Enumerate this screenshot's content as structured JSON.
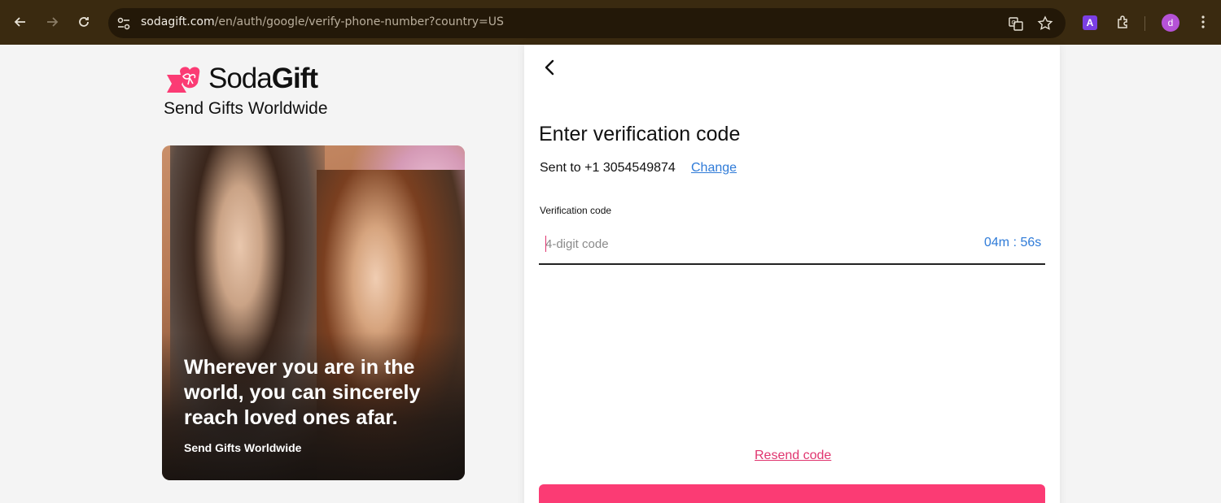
{
  "browser": {
    "url_host": "sodagift.com",
    "url_path": "/en/auth/google/verify-phone-number?country=US",
    "extension_label": "A",
    "profile_initial": "d"
  },
  "brand": {
    "name_light": "Soda",
    "name_bold": "Gift",
    "tagline": "Send Gifts Worldwide",
    "accent_color": "#fb3b74"
  },
  "promo": {
    "headline": "Wherever you are in the world, you can sincerely reach loved ones afar.",
    "caption": "Send Gifts Worldwide"
  },
  "verify": {
    "title": "Enter verification code",
    "sent_to": "Sent to +1 3054549874",
    "change_link": "Change",
    "field_label": "Verification code",
    "placeholder": "4-digit code",
    "timer": "04m : 56s",
    "resend_link": "Resend code"
  }
}
